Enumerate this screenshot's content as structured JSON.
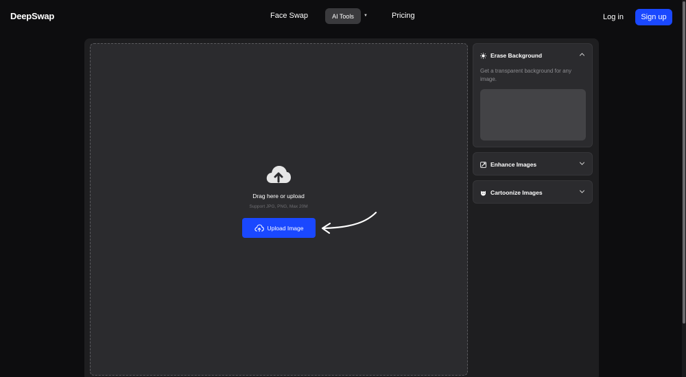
{
  "header": {
    "logo": "DeepSwap",
    "nav": {
      "face_swap": "Face Swap",
      "ai_tools": "AI Tools",
      "pricing": "Pricing"
    },
    "login": "Log in",
    "signup": "Sign up",
    "accent": "#1a48ff"
  },
  "upload": {
    "drag_text": "Drag here or upload",
    "support_text": "Support JPG, PNG, Max 20M",
    "button_label": "Upload Image",
    "icon": "cloud-upload-icon"
  },
  "sidebar": {
    "tools": [
      {
        "label": "Erase Background",
        "icon": "sparkle-icon",
        "expanded": true,
        "description": "Get a transparent background for any image."
      },
      {
        "label": "Enhance Images",
        "icon": "enhance-icon",
        "expanded": false
      },
      {
        "label": "Cartoonize Images",
        "icon": "cartoon-face-icon",
        "expanded": false
      }
    ]
  }
}
